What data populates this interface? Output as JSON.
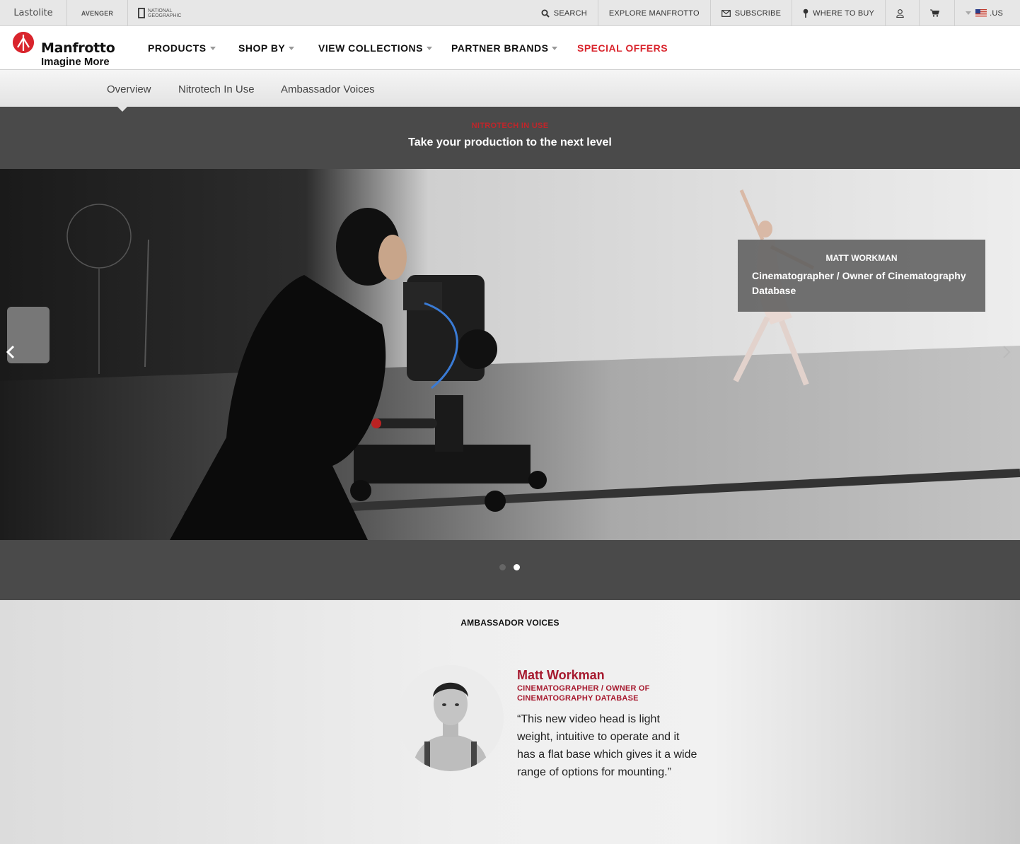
{
  "partner_bar": {
    "brands": [
      "Lastolite",
      "AVENGER",
      "NATIONAL GEOGRAPHIC"
    ],
    "utility": {
      "search": "SEARCH",
      "explore": "EXPLORE MANFROTTO",
      "subscribe": "SUBSCRIBE",
      "where_to_buy": "WHERE TO BUY",
      "region": ".US"
    }
  },
  "header": {
    "logo_name": "Manfrotto",
    "logo_tagline": "Imagine More",
    "nav": [
      {
        "label": "PRODUCTS"
      },
      {
        "label": "SHOP BY"
      },
      {
        "label": "VIEW COLLECTIONS"
      },
      {
        "label": "PARTNER BRANDS"
      },
      {
        "label": "SPECIAL OFFERS"
      }
    ]
  },
  "subnav": {
    "tabs": [
      "Overview",
      "Nitrotech In Use",
      "Ambassador Voices"
    ],
    "active_tab": "Overview"
  },
  "hero": {
    "eyebrow": "NITROTECH IN USE",
    "title": "Take your production to the next level"
  },
  "carousel": {
    "caption_name": "MATT WORKMAN",
    "caption_role": "Cinematographer / Owner of Cinematography Database",
    "slide_count": 2,
    "active_slide": 2
  },
  "ambassador": {
    "section_title": "AMBASSADOR VOICES",
    "name": "Matt Workman",
    "role": "CINEMATOGRAPHER / OWNER OF CINEMATOGRAPHY DATABASE",
    "quote": "“This new video head is light weight, intuitive to operate and it has a flat base which gives it a wide range of options for mounting.”"
  },
  "colors": {
    "brand_red": "#d9242c",
    "ambassador_red": "#a6192e",
    "band_gray": "#4a4a4a"
  }
}
